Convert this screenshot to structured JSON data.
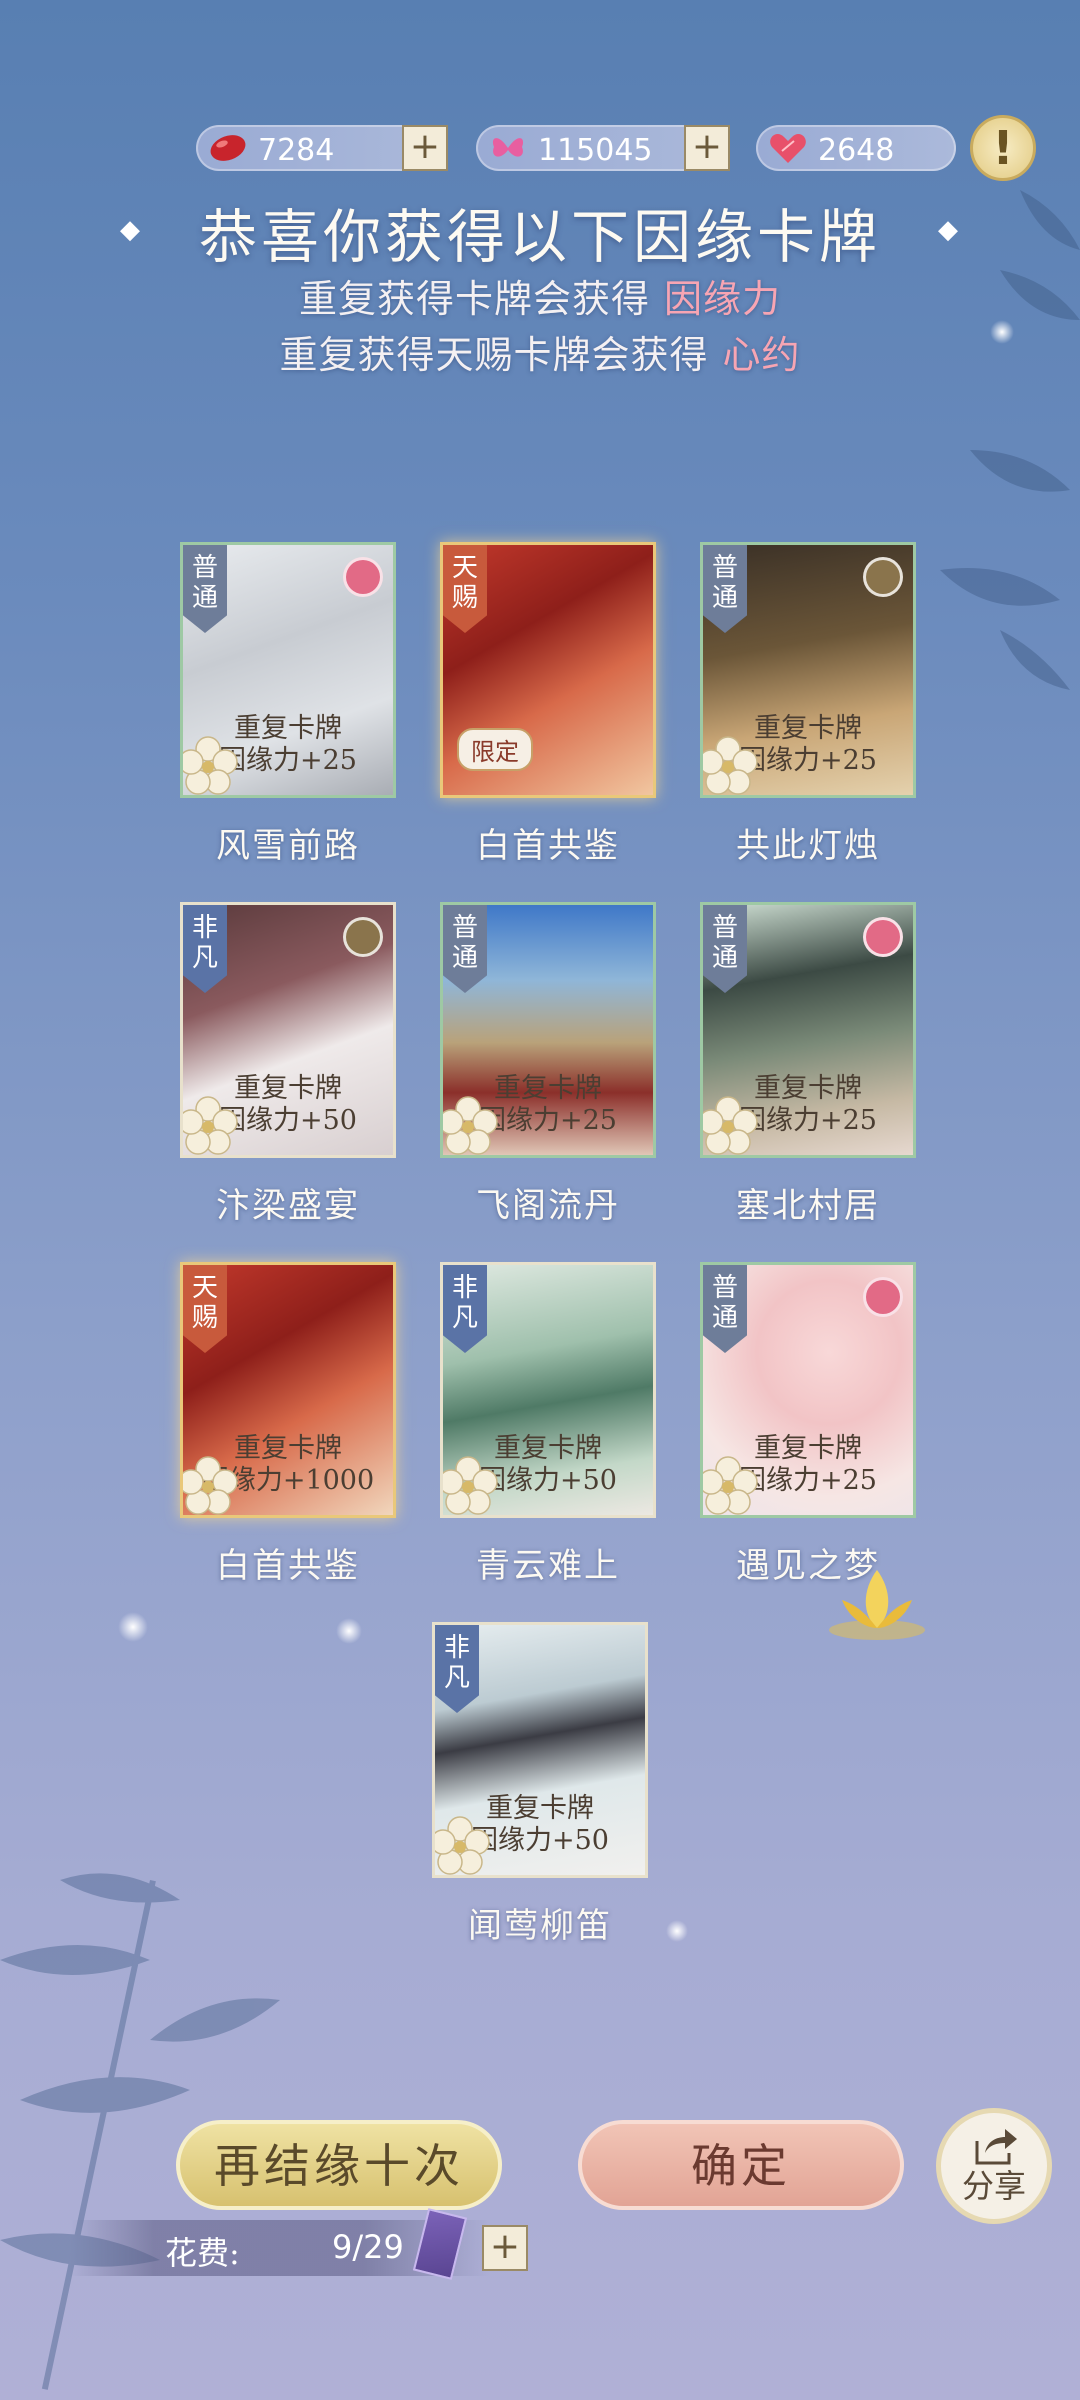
{
  "resources": [
    {
      "icon": "red-bean-icon",
      "value": "7284"
    },
    {
      "icon": "butterfly-icon",
      "value": "115045"
    },
    {
      "icon": "heart-icon",
      "value": "2648"
    }
  ],
  "plus_symbol": "+",
  "alert_symbol": "!",
  "header": {
    "title": "恭喜你获得以下因缘卡牌",
    "line1_text": "重复获得卡牌会获得",
    "line1_highlight": "因缘力",
    "line2_text": "重复获得天赐卡牌会获得",
    "line2_highlight": "心约"
  },
  "cards": [
    {
      "name": "风雪前路",
      "rarity": "普通",
      "dup_title": "重复卡牌",
      "dup_reward": "因缘力+25",
      "tag": ""
    },
    {
      "name": "白首共鉴",
      "rarity": "天赐",
      "dup_title": "",
      "dup_reward": "",
      "tag": "限定"
    },
    {
      "name": "共此灯烛",
      "rarity": "普通",
      "dup_title": "重复卡牌",
      "dup_reward": "因缘力+25",
      "tag": ""
    },
    {
      "name": "汴梁盛宴",
      "rarity": "非凡",
      "dup_title": "重复卡牌",
      "dup_reward": "因缘力+50",
      "tag": ""
    },
    {
      "name": "飞阁流丹",
      "rarity": "普通",
      "dup_title": "重复卡牌",
      "dup_reward": "因缘力+25",
      "tag": ""
    },
    {
      "name": "塞北村居",
      "rarity": "普通",
      "dup_title": "重复卡牌",
      "dup_reward": "因缘力+25",
      "tag": ""
    },
    {
      "name": "白首共鉴",
      "rarity": "天赐",
      "dup_title": "重复卡牌",
      "dup_reward": "因缘力+1000",
      "tag": ""
    },
    {
      "name": "青云难上",
      "rarity": "非凡",
      "dup_title": "重复卡牌",
      "dup_reward": "因缘力+50",
      "tag": ""
    },
    {
      "name": "遇见之梦",
      "rarity": "普通",
      "dup_title": "重复卡牌",
      "dup_reward": "因缘力+25",
      "tag": ""
    },
    {
      "name": "闻莺柳笛",
      "rarity": "非凡",
      "dup_title": "重复卡牌",
      "dup_reward": "因缘力+50",
      "tag": ""
    }
  ],
  "buttons": {
    "draw_again": "再结缘十次",
    "confirm": "确定",
    "share": "分享"
  },
  "cost": {
    "label": "花费:",
    "value": "9/29"
  },
  "colors": {
    "highlight": "#f7a5b3",
    "gold_button": "#d7c16f",
    "pink_button": "#e2a495"
  }
}
